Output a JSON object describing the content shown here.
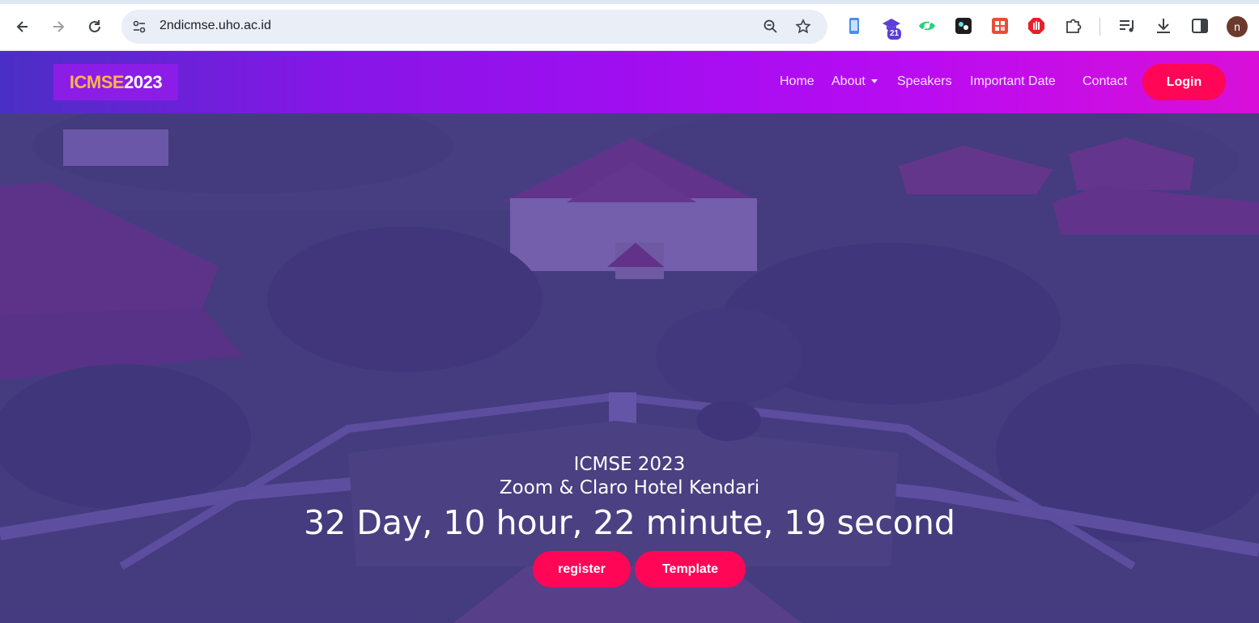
{
  "browser": {
    "url": "2ndicmse.uho.ac.id",
    "extension_badge": "21",
    "profile_initial": "n",
    "icons": [
      "back-icon",
      "forward-icon",
      "reload-icon",
      "site-info-icon",
      "zoom-icon",
      "bookmark-star-icon",
      "phone-extension-icon",
      "graduation-cap-extension-icon",
      "eye-extension-icon",
      "game-extension-icon",
      "grid-extension-icon",
      "stop-hand-extension-icon",
      "puzzle-extensions-icon",
      "media-queue-icon",
      "download-icon",
      "side-panel-icon"
    ]
  },
  "site": {
    "logo_part1": "ICMSE",
    "logo_part2": "2023",
    "nav": {
      "home": "Home",
      "about": "About",
      "speakers": "Speakers",
      "important_date": "Important Date",
      "contact": "Contact"
    },
    "login": "Login"
  },
  "hero": {
    "title": "ICMSE 2023",
    "venue": "Zoom & Claro Hotel Kendari",
    "countdown": "32 Day, 10 hour, 22 minute, 19 second",
    "register": "register",
    "template": "Template"
  },
  "colors": {
    "accent_button": "#ff0657",
    "logo_highlight": "#ffb347",
    "header_start": "#4a2fc4",
    "header_end": "#d90fd8",
    "hero_overlay": "#482ea0"
  }
}
